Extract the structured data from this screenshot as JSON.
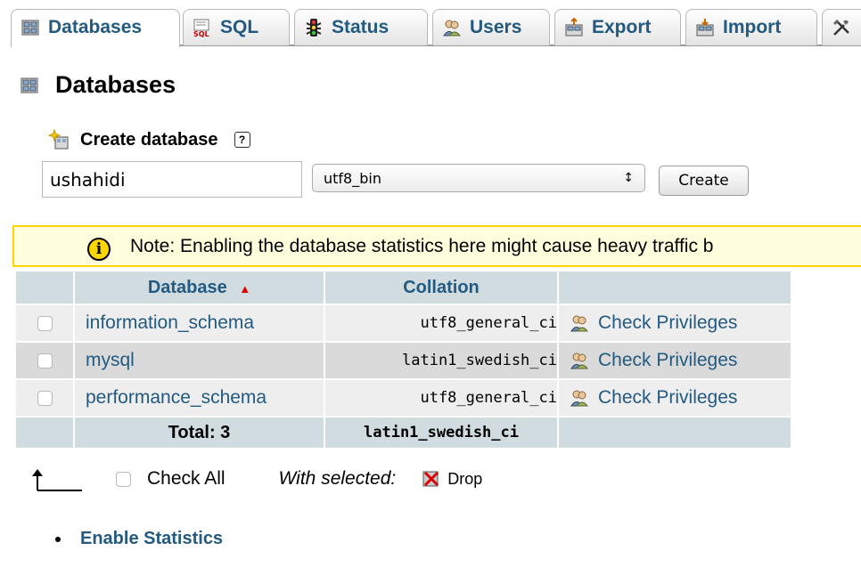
{
  "tabs": [
    {
      "label": "Databases",
      "icon": "database-icon",
      "active": true
    },
    {
      "label": "SQL",
      "icon": "sql-icon"
    },
    {
      "label": "Status",
      "icon": "status-icon"
    },
    {
      "label": "Users",
      "icon": "users-icon"
    },
    {
      "label": "Export",
      "icon": "export-icon"
    },
    {
      "label": "Import",
      "icon": "import-icon"
    },
    {
      "label": "",
      "icon": "tools-icon"
    }
  ],
  "page": {
    "title": "Databases"
  },
  "create": {
    "heading": "Create database",
    "help": "?",
    "db_name_value": "ushahidi",
    "collation_value": "utf8_bin",
    "select_arrows": "↕",
    "button_label": "Create"
  },
  "notice": {
    "icon_text": "i",
    "text": "Note: Enabling the database statistics here might cause heavy traffic b"
  },
  "table": {
    "headers": {
      "database": "Database",
      "sort_indicator": "▲",
      "collation": "Collation"
    },
    "rows": [
      {
        "database": "information_schema",
        "collation": "utf8_general_ci",
        "action": "Check Privileges"
      },
      {
        "database": "mysql",
        "collation": "latin1_swedish_ci",
        "action": "Check Privileges"
      },
      {
        "database": "performance_schema",
        "collation": "utf8_general_ci",
        "action": "Check Privileges"
      }
    ],
    "footer": {
      "total": "Total: 3",
      "collation": "latin1_swedish_ci"
    }
  },
  "bulk": {
    "check_all": "Check All",
    "with_selected": "With selected:",
    "drop": "Drop"
  },
  "enable_statistics": "Enable Statistics",
  "colors": {
    "link": "#235a81",
    "header_bg": "#d0dce0",
    "notice_bg": "#ffffdd",
    "notice_border": "#ffd700"
  }
}
